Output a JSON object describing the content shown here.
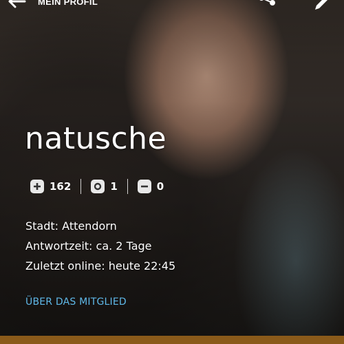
{
  "topbar": {
    "title": "MEIN PROFIL",
    "back_icon": "arrow-left-icon",
    "share_icon": "share-icon",
    "edit_icon": "pencil-icon"
  },
  "profile": {
    "username": "natusche",
    "stats": [
      {
        "icon": "plus-bubble-icon",
        "value": "162"
      },
      {
        "icon": "question-bubble-icon",
        "value": "1"
      },
      {
        "icon": "minus-bubble-icon",
        "value": "0"
      }
    ],
    "info": [
      {
        "label": "Stadt:",
        "value": "Attendorn"
      },
      {
        "label": "Antwortzeit:",
        "value": "ca. 2 Tage"
      },
      {
        "label": "Zuletzt online:",
        "value": "heute 22:45"
      }
    ],
    "about_link": "ÜBER DAS MITGLIED"
  },
  "colors": {
    "link": "#5fb8e8",
    "accent_bar": "#8a5a1a",
    "text": "#ffffff"
  }
}
